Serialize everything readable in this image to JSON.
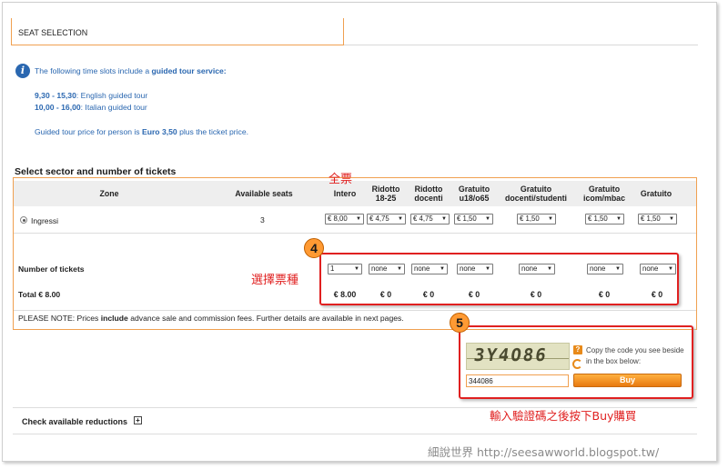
{
  "header": {
    "tab_label": "SEAT SELECTION"
  },
  "info": {
    "line1_pre": "The following time slots include a ",
    "line1_bold": "guided tour service:",
    "slot1_time": "9,30 - 15,30",
    "slot1_desc": ": English guided tour",
    "slot2_time": "10,00 - 16,00",
    "slot2_desc": ": Italian guided tour",
    "price_pre": "Guided tour price for person is ",
    "price_bold": "Euro 3,50",
    "price_post": " plus the ticket price."
  },
  "section_title": "Select sector and number of tickets",
  "table": {
    "col_zone": "Zone",
    "col_seats": "Available seats",
    "ticket_types": [
      {
        "line1": "Intero",
        "line2": ""
      },
      {
        "line1": "Ridotto",
        "line2": "18-25"
      },
      {
        "line1": "Ridotto",
        "line2": "docenti"
      },
      {
        "line1": "Gratuito",
        "line2": "u18/o65"
      },
      {
        "line1": "Gratuito",
        "line2": "docenti/studenti"
      },
      {
        "line1": "Gratuito",
        "line2": "icom/mbac"
      },
      {
        "line1": "Gratuito",
        "line2": ""
      }
    ],
    "zone_name": "Ingressi",
    "available_seats": "3",
    "unit_prices": [
      "€ 8,00",
      "€ 4,75",
      "€ 4,75",
      "€ 1,50",
      "€ 1,50",
      "€ 1,50",
      "€ 1,50"
    ],
    "number_label": "Number of tickets",
    "quantities": [
      "1",
      "none",
      "none",
      "none",
      "none",
      "none",
      "none"
    ],
    "total_label": "Total € 8.00",
    "totals": [
      "€ 8.00",
      "€ 0",
      "€ 0",
      "€ 0",
      "€ 0",
      "€ 0",
      "€ 0"
    ],
    "note_pre": "PLEASE NOTE: Prices ",
    "note_bold": "include",
    "note_post": " advance sale and commission fees. Further details are available in next pages."
  },
  "captcha": {
    "image_text": "3Y4O86",
    "hint": "Copy the code you see beside in the box below:",
    "help_symbol": "?",
    "input_value": "344086",
    "buy_label": "Buy"
  },
  "reductions": {
    "label": "Check available reductions",
    "toggle_symbol": "+"
  },
  "annotations": {
    "full_ticket": "全票",
    "choose_type": "選擇票種",
    "step4": "4",
    "step5": "5",
    "captcha_instruction": "輸入驗證碼之後按下Buy購買"
  },
  "watermark": "細說世界 http://seesawworld.blogspot.tw/"
}
